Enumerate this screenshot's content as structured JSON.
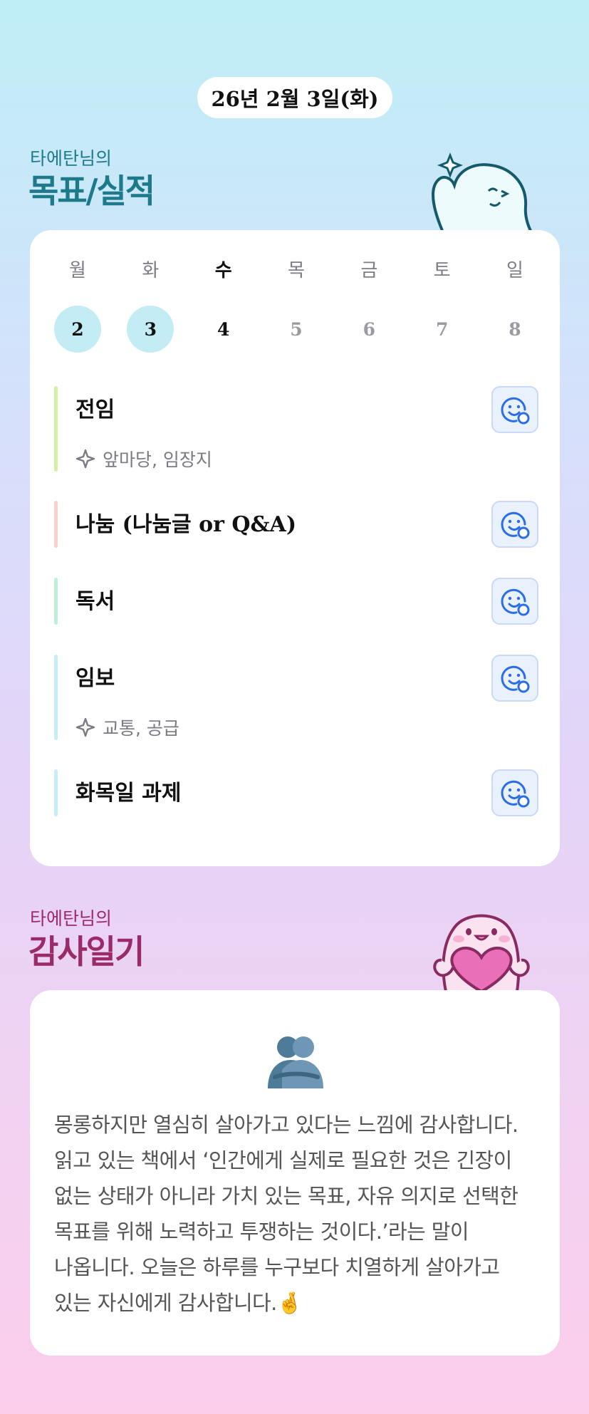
{
  "header": {
    "date": "26년 2월 3일(화)"
  },
  "goals_section": {
    "subtitle": "타에탄님의",
    "title": "목표/실적"
  },
  "week": [
    {
      "dow": "월",
      "num": "2",
      "state": "done"
    },
    {
      "dow": "화",
      "num": "3",
      "state": "done"
    },
    {
      "dow": "수",
      "num": "4",
      "state": "today"
    },
    {
      "dow": "목",
      "num": "5",
      "state": "future"
    },
    {
      "dow": "금",
      "num": "6",
      "state": "future"
    },
    {
      "dow": "토",
      "num": "7",
      "state": "future"
    },
    {
      "dow": "일",
      "num": "8",
      "state": "future"
    }
  ],
  "goals": [
    {
      "name": "전임",
      "tag": "앞마당, 임장지",
      "bar_color": "#d6efa8",
      "icon": "smile-emoji-add-icon"
    },
    {
      "name": "나눔 (나눔글 or Q&A)",
      "bar_color": "#f9d0cc",
      "icon": "smile-emoji-add-icon"
    },
    {
      "name": "독서",
      "bar_color": "#bdf0d8",
      "icon": "smile-emoji-add-icon"
    },
    {
      "name": "임보",
      "tag": "교통, 공급",
      "bar_color": "#c6eef6",
      "icon": "smile-emoji-add-icon"
    },
    {
      "name": "화목일 과제",
      "bar_color": "#c6eef6",
      "icon": "smile-emoji-add-icon"
    }
  ],
  "gratitude_section": {
    "subtitle": "타에탄님의",
    "title": "감사일기"
  },
  "gratitude": {
    "icon": "hugging-people-icon",
    "text": "몽롱하지만 열심히 살아가고 있다는 느낌에 감사합니다. 읽고 있는 책에서 ‘인간에게 실제로 필요한 것은 긴장이 없는 상태가 아니라 가치 있는 목표, 자유 의지로 선택한 목표를 위해 노력하고 투쟁하는 것이다.’라는 말이 나옵니다. 오늘은 하루를 누구보다 치열하게 살아가고 있는 자신에게 감사합니다.🤞"
  },
  "colors": {
    "goal_accent": "#1d7a8a",
    "gratitude_accent": "#9b2a6a",
    "emoji_button": "#2a6de8"
  }
}
